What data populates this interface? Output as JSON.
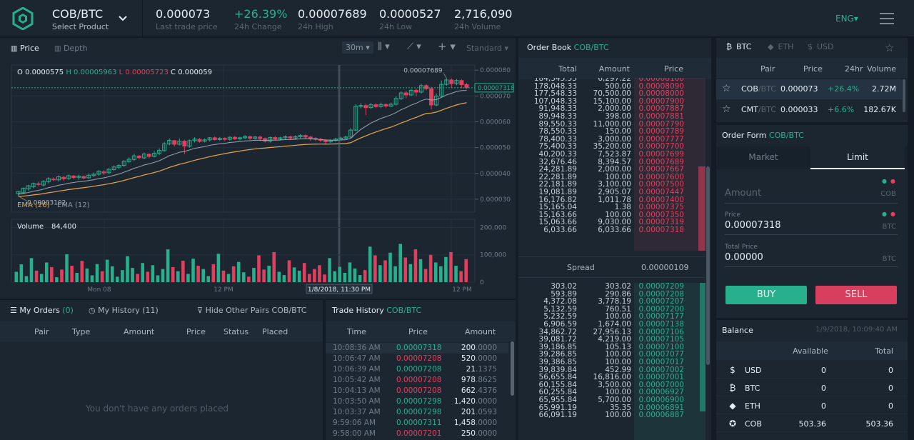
{
  "header": {
    "pair": "COB/BTC",
    "select_label": "Select Product",
    "stats": [
      {
        "value": "0.000073",
        "label": "Last trade price",
        "up": false
      },
      {
        "value": "+26.39%",
        "label": "24h Change",
        "up": true
      },
      {
        "value": "0.00007689",
        "label": "24h High",
        "up": false
      },
      {
        "value": "0.0000527",
        "label": "24h Low",
        "up": false
      },
      {
        "value": "2,716,090",
        "label": "24h Volume",
        "up": false
      }
    ],
    "language": "ENG"
  },
  "chart_toolbar": {
    "price_tab": "Price",
    "depth_tab": "Depth",
    "interval": "30m",
    "mode": "Standard"
  },
  "chart_data": [
    {
      "type": "candlestick",
      "title": "",
      "ohlc": {
        "o": "0.0000575",
        "h": "0.00005963",
        "l": "0.00005723",
        "c": "0.000059"
      },
      "ylim": [
        2.5e-05,
        8.2e-05
      ],
      "y_ticks": [
        "0.000080",
        "0.000070",
        "0.000060",
        "0.000050",
        "0.000040",
        "0.000030"
      ],
      "current_price": "0.00007318",
      "annotations": {
        "high": "0.00007689",
        "low": "0.00003102"
      },
      "legend": [
        "EMA (26)",
        "EMA (12)"
      ],
      "colors": {
        "up": "#28b08d",
        "down": "#e0405e",
        "ema26": "#e8a54a",
        "ema12": "#9aa5b1"
      },
      "candles": [
        [
          3.22e-05,
          3.3e-05,
          3.12e-05,
          3.31e-05
        ],
        [
          3.25e-05,
          3.43e-05,
          3.2e-05,
          3.45e-05
        ],
        [
          3.4e-05,
          3.52e-05,
          3.34e-05,
          3.56e-05
        ],
        [
          3.48e-05,
          3.61e-05,
          3.43e-05,
          3.65e-05
        ],
        [
          3.6e-05,
          3.57e-05,
          3.5e-05,
          3.68e-05
        ],
        [
          3.55e-05,
          3.69e-05,
          3.5e-05,
          3.74e-05
        ],
        [
          3.68e-05,
          3.8e-05,
          3.61e-05,
          3.86e-05
        ],
        [
          3.78e-05,
          3.76e-05,
          3.7e-05,
          3.85e-05
        ],
        [
          3.75e-05,
          3.87e-05,
          3.69e-05,
          3.92e-05
        ],
        [
          3.85e-05,
          3.79e-05,
          3.72e-05,
          3.9e-05
        ],
        [
          3.8e-05,
          3.91e-05,
          3.75e-05,
          3.96e-05
        ],
        [
          3.9e-05,
          3.84e-05,
          3.78e-05,
          3.94e-05
        ],
        [
          3.85e-05,
          3.89e-05,
          3.76e-05,
          3.95e-05
        ],
        [
          3.88e-05,
          3.82e-05,
          3.77e-05,
          3.92e-05
        ],
        [
          3.83e-05,
          3.93e-05,
          3.79e-05,
          3.99e-05
        ],
        [
          3.92e-05,
          3.97e-05,
          3.86e-05,
          4.04e-05
        ],
        [
          3.97e-05,
          4.08e-05,
          3.91e-05,
          4.13e-05
        ],
        [
          4.06e-05,
          4.02e-05,
          3.95e-05,
          4.12e-05
        ],
        [
          4.03e-05,
          4.16e-05,
          3.98e-05,
          4.21e-05
        ],
        [
          4.15e-05,
          4.25e-05,
          4.09e-05,
          4.31e-05
        ],
        [
          4.24e-05,
          4.31e-05,
          4.17e-05,
          4.36e-05
        ],
        [
          4.31e-05,
          4.47e-05,
          4.25e-05,
          4.52e-05
        ],
        [
          4.46e-05,
          4.55e-05,
          4.4e-05,
          4.62e-05
        ],
        [
          4.54e-05,
          4.68e-05,
          4.48e-05,
          4.76e-05
        ],
        [
          4.67e-05,
          4.61e-05,
          4.55e-05,
          4.72e-05
        ],
        [
          4.6e-05,
          4.75e-05,
          4.55e-05,
          4.81e-05
        ],
        [
          4.74e-05,
          4.66e-05,
          4.59e-05,
          4.78e-05
        ],
        [
          4.66e-05,
          4.78e-05,
          4.62e-05,
          4.86e-05
        ],
        [
          4.78e-05,
          4.89e-05,
          4.71e-05,
          4.97e-05
        ],
        [
          4.88e-05,
          5.15e-05,
          4.84e-05,
          5.22e-05
        ],
        [
          5.14e-05,
          5.28e-05,
          5.09e-05,
          5.36e-05
        ],
        [
          5.27e-05,
          5.13e-05,
          5.05e-05,
          5.3e-05
        ],
        [
          5.13e-05,
          5.25e-05,
          5.08e-05,
          5.35e-05
        ],
        [
          5.25e-05,
          5.06e-05,
          4.75e-05,
          5.3e-05
        ],
        [
          5.06e-05,
          5.27e-05,
          5e-05,
          5.31e-05
        ],
        [
          5.27e-05,
          5.33e-05,
          5.2e-05,
          5.4e-05
        ],
        [
          5.32e-05,
          5.24e-05,
          5.19e-05,
          5.37e-05
        ],
        [
          5.25e-05,
          5.3e-05,
          5.2e-05,
          5.36e-05
        ],
        [
          5.3e-05,
          5.38e-05,
          5.24e-05,
          5.41e-05
        ],
        [
          5.38e-05,
          5.31e-05,
          5.27e-05,
          5.43e-05
        ],
        [
          5.31e-05,
          5.36e-05,
          5.26e-05,
          5.41e-05
        ],
        [
          5.36e-05,
          5.32e-05,
          5.25e-05,
          5.4e-05
        ],
        [
          5.32e-05,
          5.4e-05,
          5.27e-05,
          5.44e-05
        ],
        [
          5.4e-05,
          5.34e-05,
          5.3e-05,
          5.45e-05
        ],
        [
          5.34e-05,
          5.38e-05,
          5.28e-05,
          5.42e-05
        ],
        [
          5.38e-05,
          5.43e-05,
          5.32e-05,
          5.48e-05
        ],
        [
          5.42e-05,
          5.36e-05,
          5.29e-05,
          5.46e-05
        ],
        [
          5.36e-05,
          5.41e-05,
          5.31e-05,
          5.45e-05
        ],
        [
          5.41e-05,
          5.35e-05,
          5.26e-05,
          5.46e-05
        ],
        [
          5.35e-05,
          5.25e-05,
          5.2e-05,
          5.39e-05
        ],
        [
          5.25e-05,
          5.39e-05,
          5.2e-05,
          5.43e-05
        ],
        [
          5.39e-05,
          5.33e-05,
          5.28e-05,
          5.44e-05
        ],
        [
          5.33e-05,
          5.38e-05,
          5.27e-05,
          5.42e-05
        ],
        [
          5.38e-05,
          5.42e-05,
          5.33e-05,
          5.47e-05
        ],
        [
          5.42e-05,
          5.37e-05,
          5.31e-05,
          5.46e-05
        ],
        [
          5.37e-05,
          5.42e-05,
          5.32e-05,
          5.47e-05
        ],
        [
          5.42e-05,
          5.47e-05,
          5.36e-05,
          5.52e-05
        ],
        [
          5.47e-05,
          5.41e-05,
          5.35e-05,
          5.51e-05
        ],
        [
          5.41e-05,
          5.36e-05,
          5.27e-05,
          5.45e-05
        ],
        [
          5.36e-05,
          5.32e-05,
          5.26e-05,
          5.4e-05
        ],
        [
          5.32e-05,
          5.28e-05,
          5.22e-05,
          5.37e-05
        ],
        [
          5.28e-05,
          5.23e-05,
          5.15e-05,
          5.33e-05
        ],
        [
          5.23e-05,
          5.28e-05,
          5.18e-05,
          5.33e-05
        ],
        [
          5.28e-05,
          5.33e-05,
          5.23e-05,
          5.38e-05
        ],
        [
          5.33e-05,
          5.37e-05,
          5.28e-05,
          5.42e-05
        ],
        [
          5.37e-05,
          5.41e-05,
          5.32e-05,
          5.46e-05
        ],
        [
          5.41e-05,
          5.68e-05,
          5.37e-05,
          5.76e-05
        ],
        [
          5.68e-05,
          6.6e-05,
          5.63e-05,
          6.68e-05
        ],
        [
          6.6e-05,
          6.63e-05,
          6.52e-05,
          6.72e-05
        ],
        [
          6.63e-05,
          6.55e-05,
          6.26e-05,
          6.71e-05
        ],
        [
          6.55e-05,
          6.66e-05,
          6.5e-05,
          6.73e-05
        ],
        [
          6.66e-05,
          6.59e-05,
          6.53e-05,
          6.72e-05
        ],
        [
          6.59e-05,
          6.67e-05,
          6.54e-05,
          6.74e-05
        ],
        [
          6.67e-05,
          6.61e-05,
          6.55e-05,
          6.71e-05
        ],
        [
          6.61e-05,
          6.68e-05,
          6.56e-05,
          6.75e-05
        ],
        [
          6.68e-05,
          6.9e-05,
          6.63e-05,
          6.99e-05
        ],
        [
          6.9e-05,
          7.12e-05,
          6.84e-05,
          7.18e-05
        ],
        [
          7.12e-05,
          7.04e-05,
          6.91e-05,
          7.2e-05
        ],
        [
          7.04e-05,
          7.22e-05,
          6.99e-05,
          7.28e-05
        ],
        [
          7.22e-05,
          7.15e-05,
          6.99e-05,
          7.29e-05
        ],
        [
          7.15e-05,
          7.4e-05,
          7.1e-05,
          7.47e-05
        ],
        [
          7.4e-05,
          7.28e-05,
          7.22e-05,
          7.46e-05
        ],
        [
          7.28e-05,
          6.65e-05,
          6.48e-05,
          7.35e-05
        ],
        [
          6.65e-05,
          7e-05,
          6.6e-05,
          7.1e-05
        ],
        [
          7e-05,
          7.45e-05,
          6.95e-05,
          7.6e-05
        ],
        [
          7.45e-05,
          7.62e-05,
          7.4e-05,
          7.69e-05
        ],
        [
          7.62e-05,
          7.48e-05,
          7.32e-05,
          7.68e-05
        ],
        [
          7.48e-05,
          7.6e-05,
          7.42e-05,
          7.66e-05
        ],
        [
          7.6e-05,
          7.44e-05,
          7.3e-05,
          7.65e-05
        ],
        [
          7.44e-05,
          7.32e-05,
          7.28e-05,
          7.5e-05
        ]
      ]
    },
    {
      "type": "bar",
      "title": "Volume",
      "current_value": "84,400",
      "ylim": [
        0,
        230000
      ],
      "y_ticks": [
        "200,000",
        "100,000",
        "0"
      ],
      "x_ticks": [
        "Mon 08",
        "12 PM",
        "12 PM"
      ],
      "crosshair_label": "1/8/2018, 11:30 PM",
      "values": [
        38000,
        65000,
        22000,
        88000,
        42000,
        30000,
        72000,
        55000,
        18000,
        46000,
        102000,
        60000,
        34000,
        78000,
        50000,
        25000,
        66000,
        40000,
        82000,
        58000,
        20000,
        44000,
        95000,
        52000,
        30000,
        70000,
        38000,
        62000,
        25000,
        48000,
        120000,
        55000,
        40000,
        78000,
        30000,
        86000,
        60000,
        48000,
        22000,
        66000,
        104000,
        42000,
        30000,
        58000,
        74000,
        36000,
        20000,
        52000,
        98000,
        46000,
        60000,
        110000,
        38000,
        26000,
        80000,
        54000,
        42000,
        70000,
        30000,
        48000,
        62000,
        28000,
        88000,
        40000,
        56000,
        34000,
        72000,
        50000,
        26000,
        44000,
        130000,
        98000,
        62000,
        80000,
        108000,
        58000,
        140000,
        90000,
        66000,
        120000,
        84000,
        48000,
        100000,
        72000,
        58000,
        92000,
        110000,
        60000,
        40000,
        84400
      ]
    }
  ],
  "order_book": {
    "title": "Order Book",
    "pair": "COB/BTC",
    "headers": [
      "Total",
      "Amount",
      "Price"
    ],
    "spread_label": "Spread",
    "spread_value": "0.00000109",
    "asks": [
      [
        "184,345.55",
        "6,297.22",
        "0.00008100"
      ],
      [
        "178,048.33",
        "500.00",
        "0.00008090"
      ],
      [
        "177,548.33",
        "70,500.00",
        "0.00008000"
      ],
      [
        "107,048.33",
        "15,100.00",
        "0.00007900"
      ],
      [
        "91,948.33",
        "2,000.00",
        "0.00007887"
      ],
      [
        "89,948.33",
        "398.00",
        "0.00007881"
      ],
      [
        "89,550.33",
        "11,000.00",
        "0.00007790"
      ],
      [
        "78,550.33",
        "150.00",
        "0.00007789"
      ],
      [
        "78,400.33",
        "3,000.00",
        "0.00007777"
      ],
      [
        "75,400.33",
        "35,200.00",
        "0.00007700"
      ],
      [
        "40,200.33",
        "7,523.87",
        "0.00007699"
      ],
      [
        "32,676.46",
        "8,394.57",
        "0.00007689"
      ],
      [
        "24,281.89",
        "2,000.00",
        "0.00007667"
      ],
      [
        "22,281.89",
        "100.00",
        "0.00007600"
      ],
      [
        "22,181.89",
        "3,100.00",
        "0.00007500"
      ],
      [
        "19,081.89",
        "2,905.07",
        "0.00007447"
      ],
      [
        "16,176.82",
        "1,011.78",
        "0.00007400"
      ],
      [
        "15,165.04",
        "1.38",
        "0.00007375"
      ],
      [
        "15,163.66",
        "100.00",
        "0.00007350"
      ],
      [
        "15,063.66",
        "9,030.00",
        "0.00007319"
      ],
      [
        "6,033.66",
        "6,033.66",
        "0.00007318"
      ]
    ],
    "bids": [
      [
        "303.02",
        "303.02",
        "0.00007209"
      ],
      [
        "593.89",
        "290.86",
        "0.00007208"
      ],
      [
        "4,372.08",
        "3,778.19",
        "0.00007207"
      ],
      [
        "5,132.59",
        "760.51",
        "0.00007200"
      ],
      [
        "5,232.59",
        "100.00",
        "0.00007177"
      ],
      [
        "6,906.59",
        "1,674.00",
        "0.00007138"
      ],
      [
        "34,862.72",
        "27,956.13",
        "0.00007106"
      ],
      [
        "39,081.72",
        "4,219.00",
        "0.00007105"
      ],
      [
        "39,186.85",
        "105.13",
        "0.00007100"
      ],
      [
        "39,286.85",
        "100.00",
        "0.00007077"
      ],
      [
        "39,386.85",
        "100.00",
        "0.00007017"
      ],
      [
        "39,839.84",
        "452.99",
        "0.00007002"
      ],
      [
        "56,655.84",
        "16,816.00",
        "0.00007001"
      ],
      [
        "60,155.84",
        "3,500.00",
        "0.00007000"
      ],
      [
        "60,255.84",
        "100.00",
        "0.00006927"
      ],
      [
        "65,955.84",
        "5,700.00",
        "0.00006900"
      ],
      [
        "65,991.19",
        "35.35",
        "0.00006891"
      ],
      [
        "66,091.19",
        "100.00",
        "0.00006887"
      ]
    ]
  },
  "markets": {
    "tabs": [
      "BTC",
      "ETH",
      "USD"
    ],
    "headers": [
      "Pair",
      "Price",
      "24hr",
      "Volume"
    ],
    "rows": [
      {
        "base": "COB",
        "quote": "/BTC",
        "price": "0.000073",
        "change": "+26.4%",
        "volume": "2.72M"
      },
      {
        "base": "CMT",
        "quote": "/BTC",
        "price": "0.000033",
        "change": "+6.6%",
        "volume": "182.67K"
      }
    ]
  },
  "order_form": {
    "title": "Order Form",
    "pair": "COB/BTC",
    "tabs": [
      "Market",
      "Limit"
    ],
    "amount_placeholder": "Amount",
    "amount_unit": "COB",
    "price_label": "Price",
    "price_value": "0.00007318",
    "price_unit": "BTC",
    "total_label": "Total Price",
    "total_value": "0.00000",
    "total_unit": "BTC",
    "buy": "BUY",
    "sell": "SELL"
  },
  "balance": {
    "title": "Balance",
    "timestamp": "1/9/2018, 10:09:40 AM",
    "headers": [
      "Available",
      "Total"
    ],
    "rows": [
      {
        "icon": "dollar-icon",
        "symbol": "$",
        "name": "USD",
        "available": "0",
        "total": "0"
      },
      {
        "icon": "bitcoin-icon",
        "symbol": "₿",
        "name": "BTC",
        "available": "0",
        "total": "0"
      },
      {
        "icon": "ethereum-icon",
        "symbol": "◆",
        "name": "ETH",
        "available": "0",
        "total": "0"
      },
      {
        "icon": "cob-icon",
        "symbol": "✪",
        "name": "COB",
        "available": "503.36",
        "total": "503.36"
      }
    ]
  },
  "my_orders": {
    "tab_orders": "My Orders",
    "orders_count": "(0)",
    "tab_history": "My History (11)",
    "hide_label": "Hide Other Pairs COB/BTC",
    "headers": [
      "Pair",
      "Type",
      "Amount",
      "Price",
      "Status",
      "Placed"
    ],
    "empty": "You don't have any orders placed"
  },
  "trade_history": {
    "title": "Trade History",
    "pair": "COB/BTC",
    "headers": [
      "Time",
      "Price",
      "Amount"
    ],
    "rows": [
      {
        "time": "10:08:36 AM",
        "price": "0.00007318",
        "amount_int": "200",
        "amount_dec": ".0000",
        "up": true
      },
      {
        "time": "10:06:47 AM",
        "price": "0.00007208",
        "amount_int": "520",
        "amount_dec": ".0000",
        "up": false
      },
      {
        "time": "10:06:39 AM",
        "price": "0.00007208",
        "amount_int": "21",
        "amount_dec": ".1375",
        "up": true
      },
      {
        "time": "10:05:42 AM",
        "price": "0.00007208",
        "amount_int": "978",
        "amount_dec": ".8625",
        "up": false
      },
      {
        "time": "10:04:13 AM",
        "price": "0.00007208",
        "amount_int": "662",
        "amount_dec": ".4376",
        "up": false
      },
      {
        "time": "10:03:50 AM",
        "price": "0.00007298",
        "amount_int": "1,420",
        "amount_dec": ".0000",
        "up": true
      },
      {
        "time": "10:03:37 AM",
        "price": "0.00007298",
        "amount_int": "201",
        "amount_dec": ".0593",
        "up": true
      },
      {
        "time": "9:59:06 AM",
        "price": "0.00007311",
        "amount_int": "1,458",
        "amount_dec": ".0000",
        "up": true
      },
      {
        "time": "9:58:00 AM",
        "price": "0.00007201",
        "amount_int": "250",
        "amount_dec": ".0000",
        "up": false
      }
    ]
  },
  "colors": {
    "up": "#28b08d",
    "down": "#e0405e",
    "accent": "#28b08d",
    "panel": "#1b2631",
    "bg": "#131c25"
  }
}
